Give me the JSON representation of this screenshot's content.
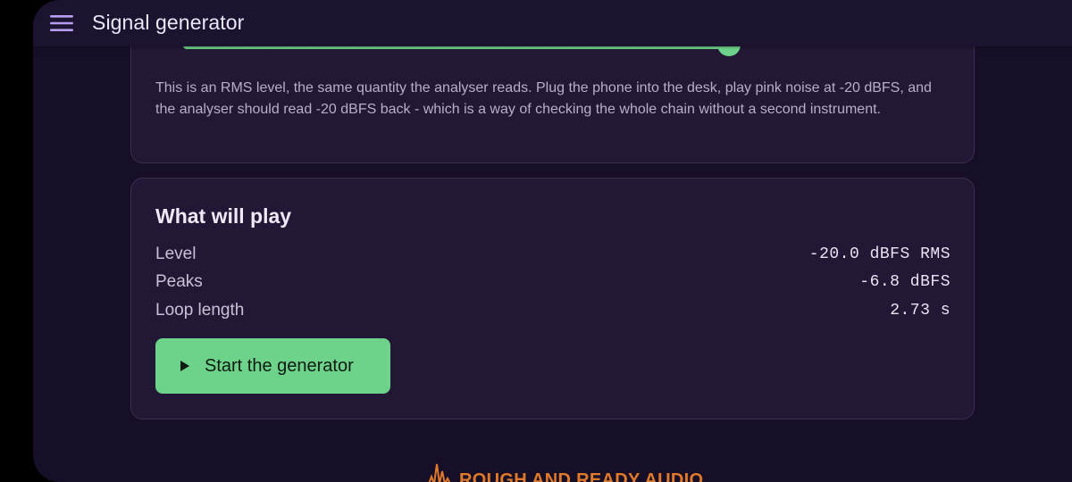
{
  "app_bar": {
    "title": "Signal generator",
    "menu_icon": "hamburger-menu-icon"
  },
  "level_card": {
    "slider_fraction": 0.74,
    "help_text": "This is an RMS level, the same quantity the analyser reads. Plug the phone into the desk, play pink noise at -20 dBFS, and the analyser should read -20 dBFS back - which is a way of checking the whole chain without a second instrument."
  },
  "play_card": {
    "title": "What will play",
    "rows": [
      {
        "label": "Level",
        "value": "-20.0 dBFS RMS"
      },
      {
        "label": "Peaks",
        "value": "-6.8 dBFS"
      },
      {
        "label": "Loop length",
        "value": "2.73 s"
      }
    ],
    "start_button": {
      "label": "Start the generator",
      "icon": "play-icon"
    }
  },
  "footer": {
    "logo_text": "ROUGH AND READY AUDIO",
    "logo_icon": "waveform-icon"
  },
  "colors": {
    "accent": "#6dd38a",
    "background": "#170f27",
    "card": "#221836",
    "menu_icon": "#b69ef0",
    "logo": "#e07a2a"
  }
}
